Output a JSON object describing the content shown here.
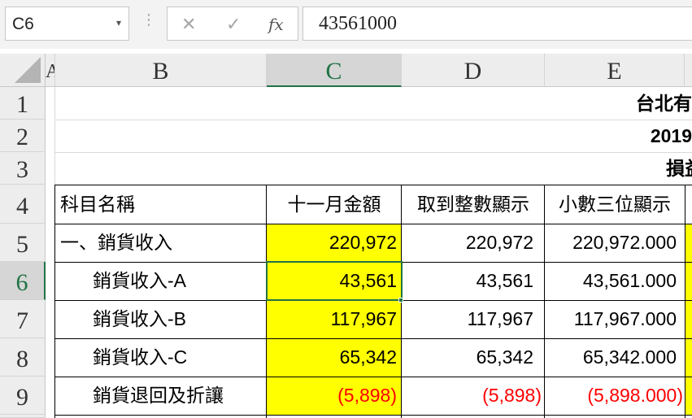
{
  "formula_bar": {
    "name_box": "C6",
    "name_box_arrow": "▾",
    "separator": "⋮",
    "cancel_icon": "✕",
    "enter_icon": "✓",
    "fx_label": "fx",
    "formula": "43561000"
  },
  "columns": [
    "A",
    "B",
    "C",
    "D",
    "E"
  ],
  "rows": [
    "1",
    "2",
    "3",
    "4",
    "5",
    "6",
    "7",
    "8",
    "9"
  ],
  "title_lines": {
    "r1": "台北有",
    "r2": "2019",
    "r3": "損益"
  },
  "table": {
    "headers": [
      "科目名稱",
      "十一月金額",
      "取到整數顯示",
      "小數三位顯示"
    ],
    "rows": [
      {
        "name": "一、銷貨收入",
        "c": "220,972",
        "d": "220,972",
        "e": "220,972.000",
        "negative": false
      },
      {
        "name": "銷貨收入-A",
        "c": "43,561",
        "d": "43,561",
        "e": "43,561.000",
        "negative": false
      },
      {
        "name": "銷貨收入-B",
        "c": "117,967",
        "d": "117,967",
        "e": "117,967.000",
        "negative": false
      },
      {
        "name": "銷貨收入-C",
        "c": "65,342",
        "d": "65,342",
        "e": "65,342.000",
        "negative": false
      },
      {
        "name": "銷貨退回及折讓",
        "c": "(5,898)",
        "d": "(5,898)",
        "e": "(5,898.000)",
        "negative": true
      }
    ]
  },
  "colors": {
    "highlight": "#ffff00",
    "negative": "#ff0000",
    "selection": "#217346"
  }
}
